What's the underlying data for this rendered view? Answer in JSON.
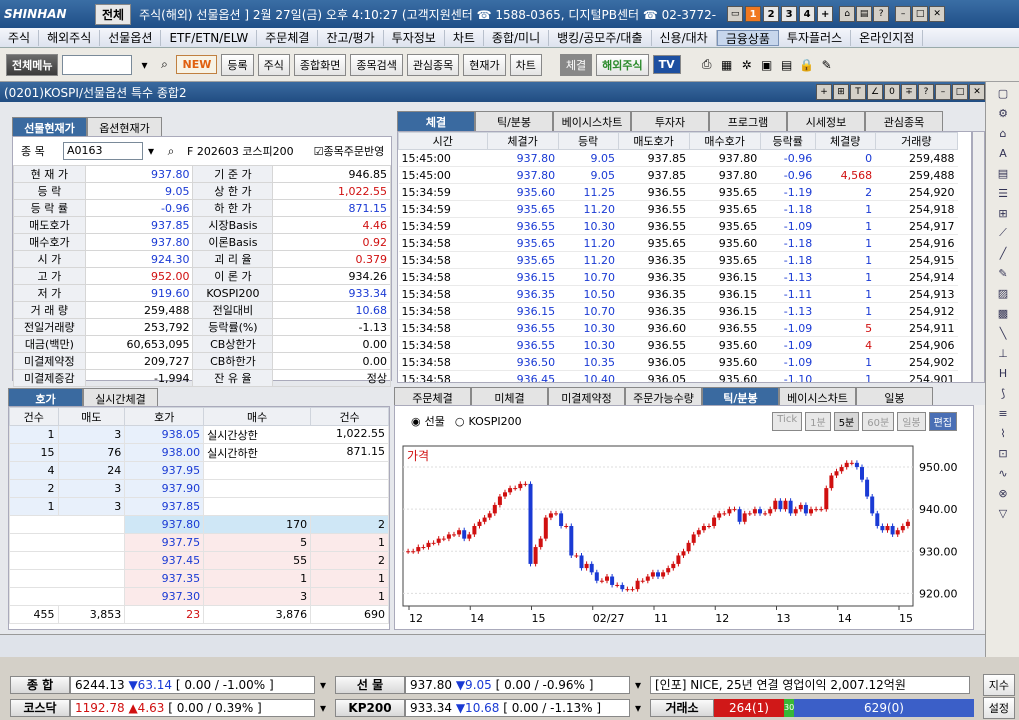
{
  "title": {
    "logo": "SHINHAN",
    "tab": "전체",
    "text": "주식(해외)  선물옵션 ] 2월 27일(금) 오후 4:10:27 (고객지원센터 ☎ 1588-0365, 디지털PB센터 ☎ 02-3772-",
    "nums": [
      "1",
      "2",
      "3",
      "4",
      "+"
    ]
  },
  "menu": [
    "주식",
    "해외주식",
    "선물옵션",
    "ETF/ETN/ELW",
    "주문체결",
    "잔고/평가",
    "투자정보",
    "차트",
    "종합/미니",
    "뱅킹/공모주/대출",
    "신용/대차",
    "금융상품",
    "투자플러스",
    "온라인지점"
  ],
  "toolbar": {
    "all_menu": "전체메뉴",
    "new": "NEW",
    "reg": "등록",
    "stock": "주식",
    "total_screen": "종합화면",
    "search": "종목검색",
    "fav": "관심종목",
    "cur_price": "현재가",
    "chart": "차트",
    "trade": "체결",
    "overseas": "해외주식",
    "tv": "TV"
  },
  "window": {
    "title": "(0201)KOSPI/선물옵션 특수 종합2"
  },
  "left_tabs": [
    "선물현재가",
    "옵션현재가"
  ],
  "code": {
    "label": "종  목",
    "value": "A0163",
    "name": "F 202603 코스피200",
    "order": "종목주문반영"
  },
  "info": [
    [
      "현 재 가",
      "937.80",
      "기 준 가",
      "946.85"
    ],
    [
      "등    락",
      "9.05",
      "상 한 가",
      "1,022.55"
    ],
    [
      "등 락 률",
      "-0.96",
      "하 한 가",
      "871.15"
    ],
    [
      "매도호가",
      "937.85",
      "시장Basis",
      "4.46"
    ],
    [
      "매수호가",
      "937.80",
      "이론Basis",
      "0.92"
    ],
    [
      "시    가",
      "924.30",
      "괴 리 율",
      "0.379"
    ],
    [
      "고    가",
      "952.00",
      "이 론 가",
      "934.26"
    ],
    [
      "저    가",
      "919.60",
      "KOSPI200",
      "933.34"
    ],
    [
      "거 래 량",
      "259,488",
      "전일대비",
      "10.68"
    ],
    [
      "전일거래량",
      "253,792",
      "등락률(%)",
      "-1.13"
    ],
    [
      "대금(백만)",
      "60,653,095",
      "CB상한가",
      "0.00"
    ],
    [
      "미결제약정",
      "209,727",
      "CB하한가",
      "0.00"
    ],
    [
      "미결제증감",
      "-1,994",
      "잔 유 율",
      "정상"
    ]
  ],
  "tick_tabs": [
    "체결",
    "틱/분봉",
    "베이시스차트",
    "투자자",
    "프로그램",
    "시세정보",
    "관심종목"
  ],
  "tick_headers": [
    "시간",
    "체결가",
    "등락",
    "매도호가",
    "매수호가",
    "등락률",
    "체결량",
    "거래량"
  ],
  "ticks": [
    [
      "15:45:00",
      "937.80",
      "9.05",
      "937.85",
      "937.80",
      "-0.96",
      "0",
      "259,488"
    ],
    [
      "15:45:00",
      "937.80",
      "9.05",
      "937.85",
      "937.80",
      "-0.96",
      "4,568",
      "259,488"
    ],
    [
      "15:34:59",
      "935.60",
      "11.25",
      "936.55",
      "935.65",
      "-1.19",
      "2",
      "254,920"
    ],
    [
      "15:34:59",
      "935.65",
      "11.20",
      "936.55",
      "935.65",
      "-1.18",
      "1",
      "254,918"
    ],
    [
      "15:34:59",
      "936.55",
      "10.30",
      "936.55",
      "935.65",
      "-1.09",
      "1",
      "254,917"
    ],
    [
      "15:34:58",
      "935.65",
      "11.20",
      "935.65",
      "935.60",
      "-1.18",
      "1",
      "254,916"
    ],
    [
      "15:34:58",
      "935.65",
      "11.20",
      "936.35",
      "935.65",
      "-1.18",
      "1",
      "254,915"
    ],
    [
      "15:34:58",
      "936.15",
      "10.70",
      "936.35",
      "936.15",
      "-1.13",
      "1",
      "254,914"
    ],
    [
      "15:34:58",
      "936.35",
      "10.50",
      "936.35",
      "936.15",
      "-1.11",
      "1",
      "254,913"
    ],
    [
      "15:34:58",
      "936.15",
      "10.70",
      "936.35",
      "936.15",
      "-1.13",
      "1",
      "254,912"
    ],
    [
      "15:34:58",
      "936.55",
      "10.30",
      "936.60",
      "936.55",
      "-1.09",
      "5",
      "254,911"
    ],
    [
      "15:34:58",
      "936.55",
      "10.30",
      "936.55",
      "935.60",
      "-1.09",
      "4",
      "254,906"
    ],
    [
      "15:34:58",
      "936.50",
      "10.35",
      "936.05",
      "935.60",
      "-1.09",
      "1",
      "254,902"
    ],
    [
      "15:34:58",
      "936.45",
      "10.40",
      "936.05",
      "935.60",
      "-1.10",
      "1",
      "254,901"
    ]
  ],
  "hoga_tabs": [
    "호가",
    "실시간체결"
  ],
  "hoga_headers": [
    "건수",
    "매도",
    "호가",
    "매수",
    "건수"
  ],
  "asks": [
    [
      "1",
      "3",
      "938.05"
    ],
    [
      "15",
      "76",
      "938.00"
    ],
    [
      "4",
      "24",
      "937.95"
    ],
    [
      "2",
      "3",
      "937.90"
    ],
    [
      "1",
      "3",
      "937.85"
    ]
  ],
  "bids": [
    [
      "937.80",
      "170",
      "2"
    ],
    [
      "937.75",
      "5",
      "1"
    ],
    [
      "937.45",
      "55",
      "2"
    ],
    [
      "937.35",
      "1",
      "1"
    ],
    [
      "937.30",
      "3",
      "1"
    ]
  ],
  "hoga_side": [
    [
      "실시간상한",
      "1,022.55"
    ],
    [
      "실시간하한",
      "871.15"
    ]
  ],
  "hoga_total": [
    "455",
    "3,853",
    "23",
    "3,876",
    "690"
  ],
  "chart_tabs": [
    "주문체결",
    "미체결",
    "미결제약정",
    "주문가능수량",
    "틱/분봉",
    "베이시스차트",
    "일봉"
  ],
  "chart_radio": [
    "선물",
    "KOSPI200"
  ],
  "chart_btns": [
    "Tick",
    "1분",
    "5분",
    "60분",
    "일봉",
    "편집"
  ],
  "chart_data": {
    "type": "candlestick",
    "title": "가격",
    "ylabel": "",
    "ylim": [
      917,
      955
    ],
    "yticks": [
      "950.00",
      "940.00",
      "930.00",
      "920.00"
    ],
    "xticks": [
      "12",
      "14",
      "15",
      "02/27",
      "11",
      "12",
      "13",
      "14",
      "15"
    ],
    "closes": [
      930,
      930,
      931,
      931,
      932,
      932,
      933,
      933,
      934,
      934,
      935,
      933,
      934,
      936,
      937,
      938,
      939,
      941,
      943,
      944,
      945,
      945,
      946,
      946,
      927,
      931,
      933,
      938,
      939,
      939,
      936,
      936,
      929,
      929,
      926,
      927,
      925,
      923,
      923,
      924,
      922,
      922,
      921,
      921,
      921,
      923,
      923,
      924,
      925,
      924,
      925,
      926,
      927,
      929,
      930,
      932,
      934,
      935,
      936,
      936,
      938,
      939,
      939,
      940,
      940,
      937,
      939,
      939,
      940,
      939,
      939,
      940,
      942,
      940,
      942,
      939,
      940,
      941,
      939,
      940,
      940,
      940,
      945,
      948,
      949,
      950,
      951,
      951,
      950,
      947,
      943,
      939,
      936,
      935,
      936,
      934,
      935,
      936,
      937
    ]
  },
  "bottom": [
    {
      "label": "종  합",
      "val": "6244.13",
      "chg": "▼63.14",
      "etc": "[ 0.00  / -1.00% ]"
    },
    {
      "label": "선  물",
      "val": "937.80",
      "chg": "▼9.05",
      "etc": "[ 0.00  / -0.96% ]"
    },
    {
      "label": "코스닥",
      "val": "1192.78",
      "chg": "▲4.63",
      "etc": "[ 0.00  / 0.39% ]"
    },
    {
      "label": "KP200",
      "val": "933.34",
      "chg": "▼10.68",
      "etc": "[ 0.00  / -1.13% ]"
    }
  ],
  "news": "[인포] NICE, 25년 연결 영업이익 2,007.12억원",
  "exchange": {
    "label": "거래소",
    "up": "264(1)",
    "mid": "30",
    "down": "629(0)"
  },
  "btns": {
    "jisu": "지수",
    "setting": "설정"
  },
  "colors": {
    "up": "#d01010",
    "down": "#1a3ad4",
    "title": "#1f4e87"
  }
}
